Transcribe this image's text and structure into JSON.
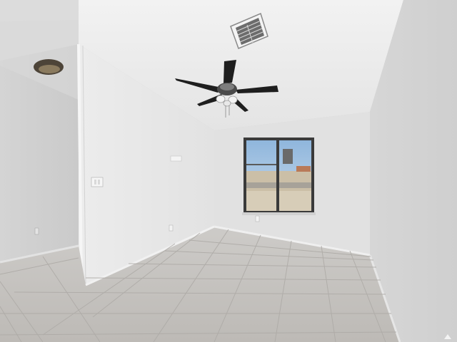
{
  "scene": {
    "description_icons": [
      "ceiling-fan-icon",
      "hvac-vent-icon",
      "ceiling-light-icon",
      "window-icon",
      "light-switch-icon",
      "outlet-icon"
    ],
    "colors": {
      "ceiling": "#e9e9e9",
      "left_wall": "#dedede",
      "back_wall": "#e3e3e3",
      "right_wall": "#d9d9d9",
      "floor_tile": "#c4c2bf",
      "grout": "#b3b0ac",
      "fan_dark": "#1e1e1e",
      "window_frame": "#3b3b3b",
      "sky": "#a9c8e6",
      "ground": "#c9bda6"
    }
  },
  "watermark": {
    "text": "",
    "icon": "realtor-logo-icon"
  }
}
